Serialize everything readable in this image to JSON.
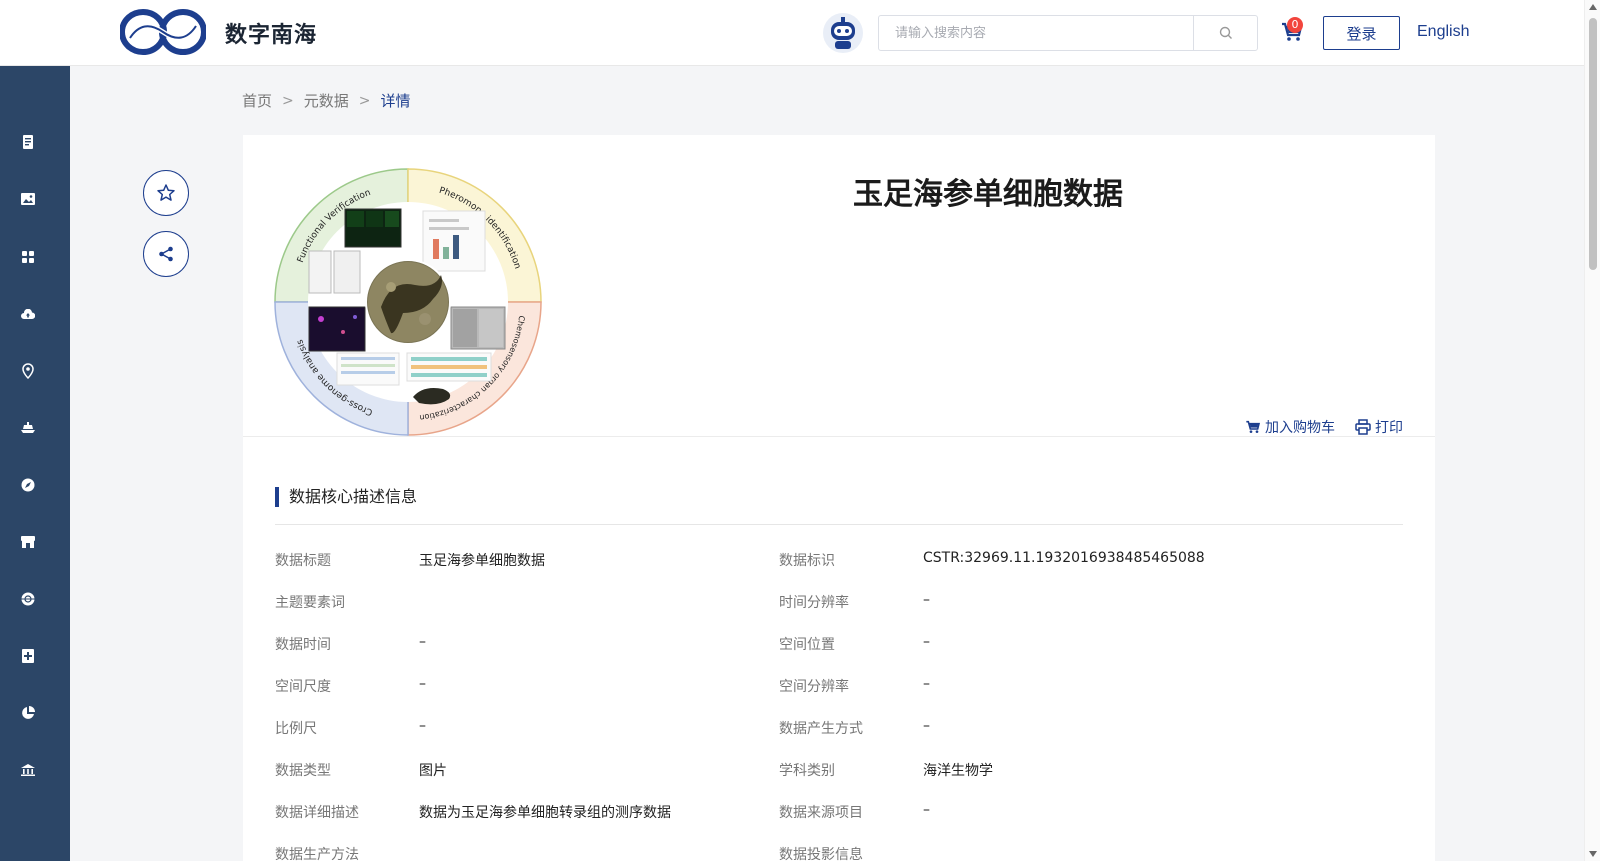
{
  "header": {
    "site_name": "数字南海",
    "search_placeholder": "请输入搜索内容",
    "cart_count": "0",
    "login_label": "登录",
    "lang_label": "English"
  },
  "sidebar": {
    "icons": [
      "document-icon",
      "image-icon",
      "grid-icon",
      "cloud-upload-icon",
      "location-pin-icon",
      "ship-icon",
      "compass-icon",
      "store-icon",
      "globe-icon",
      "plus-square-icon",
      "pie-chart-icon",
      "building-icon"
    ]
  },
  "breadcrumb": {
    "home": "首页",
    "metadata": "元数据",
    "current": "详情"
  },
  "dataset": {
    "title": "玉足海参单细胞数据",
    "add_to_cart": "加入购物车",
    "print": "打印"
  },
  "figure": {
    "quadrant_labels": [
      "Functional Verification",
      "Pheromone identification",
      "Chemosensory organ characterization",
      "Cross-genome analysis"
    ]
  },
  "section": {
    "title": "数据核心描述信息"
  },
  "info_rows": [
    {
      "label1": "数据标题",
      "value1": "玉足海参单细胞数据",
      "label2": "数据标识",
      "value2": "CSTR:32969.11.1932016938485465088"
    },
    {
      "label1": "主题要素词",
      "value1": "",
      "label2": "时间分辨率",
      "value2": "–"
    },
    {
      "label1": "数据时间",
      "value1": "–",
      "label2": "空间位置",
      "value2": "–"
    },
    {
      "label1": "空间尺度",
      "value1": "–",
      "label2": "空间分辨率",
      "value2": "–"
    },
    {
      "label1": "比例尺",
      "value1": "–",
      "label2": "数据产生方式",
      "value2": "–"
    },
    {
      "label1": "数据类型",
      "value1": "图片",
      "label2": "学科类别",
      "value2": "海洋生物学"
    },
    {
      "label1": "数据详细描述",
      "value1": "数据为玉足海参单细胞转录组的测序数据",
      "label2": "数据来源项目",
      "value2": "–"
    },
    {
      "label1": "数据生产方法",
      "value1": "",
      "label2": "数据投影信息",
      "value2": ""
    }
  ],
  "colors": {
    "brand": "#1d3e8e",
    "sidebar": "#2c4667",
    "badge": "#f2453d"
  }
}
